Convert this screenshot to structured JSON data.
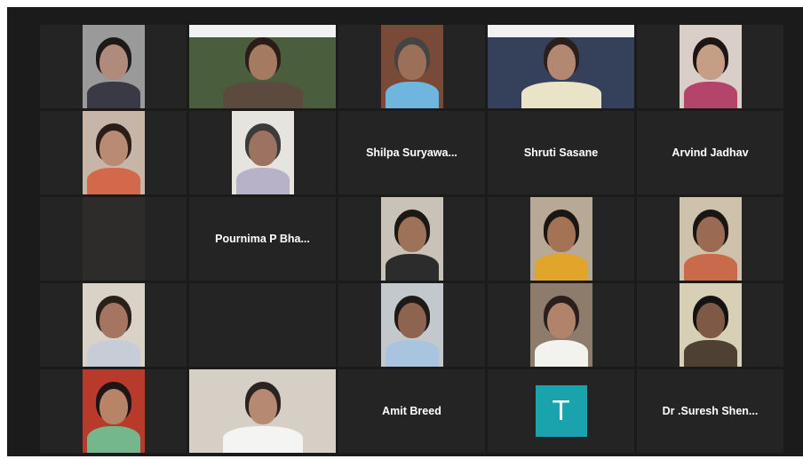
{
  "participants": [
    {
      "type": "video",
      "bg": "#9a9a9a",
      "skin": "#b08a7a",
      "hair": "#1e1a1a",
      "shirt": "#3a3a46"
    },
    {
      "type": "video",
      "bg": "#4a5d3d",
      "skin": "#a47a60",
      "hair": "#2a1d18",
      "shirt": "#5c4a3e",
      "active": true,
      "screen": true
    },
    {
      "type": "video",
      "bg": "#7a4a38",
      "skin": "#9c7058",
      "hair": "#444444",
      "shirt": "#6fb6de"
    },
    {
      "type": "video",
      "bg": "#35405a",
      "skin": "#b28872",
      "hair": "#2a1f1a",
      "shirt": "#e9e3c8",
      "screen": true
    },
    {
      "type": "video",
      "bg": "#d9cfc8",
      "skin": "#c69e86",
      "hair": "#1e1616",
      "shirt": "#b5446a"
    },
    {
      "type": "video",
      "bg": "#c7b6a8",
      "skin": "#b98a74",
      "hair": "#2a1e18",
      "shirt": "#d4684a"
    },
    {
      "type": "video",
      "bg": "#e6e4df",
      "skin": "#9c7260",
      "hair": "#3b3b3b",
      "shirt": "#b7b2c8"
    },
    {
      "type": "name",
      "name": "Shilpa  Suryawa..."
    },
    {
      "type": "name",
      "name": "Shruti Sasane"
    },
    {
      "type": "name",
      "name": "Arvind Jadhav"
    },
    {
      "type": "video",
      "bg": "#2e2b2b",
      "dark": true
    },
    {
      "type": "name",
      "name": "Pournima P Bha..."
    },
    {
      "type": "video",
      "bg": "#c9c2b9",
      "skin": "#9e7258",
      "hair": "#1c1814",
      "shirt": "#2c2c2c"
    },
    {
      "type": "video",
      "bg": "#b7a995",
      "skin": "#a47356",
      "hair": "#1a1614",
      "shirt": "#e0a52a"
    },
    {
      "type": "video",
      "bg": "#cfc2ad",
      "skin": "#9a6b52",
      "hair": "#1a1614",
      "shirt": "#c96a4a"
    },
    {
      "type": "video",
      "bg": "#d9d3c7",
      "skin": "#a47662",
      "hair": "#2a201a",
      "shirt": "#c7cdd6"
    },
    {
      "type": "empty"
    },
    {
      "type": "video",
      "bg": "#c2c8cc",
      "skin": "#8e6450",
      "hair": "#1e1a18",
      "shirt": "#a9c4de"
    },
    {
      "type": "video",
      "bg": "#8d7b6c",
      "skin": "#b0836a",
      "hair": "#2a1f1c",
      "shirt": "#f2f2ef"
    },
    {
      "type": "video",
      "bg": "#d8d0b6",
      "skin": "#7e5a46",
      "hair": "#141212",
      "shirt": "#4e4032"
    },
    {
      "type": "video",
      "bg": "#b83a2a",
      "skin": "#b88468",
      "hair": "#1e1616",
      "shirt": "#74b78c"
    },
    {
      "type": "video",
      "bg": "#d6cfc6",
      "skin": "#b68a72",
      "hair": "#2a2420",
      "shirt": "#f4f4f2",
      "wide": true
    },
    {
      "type": "name",
      "name": "Amit Breed"
    },
    {
      "type": "avatar",
      "initial": "T",
      "color": "#1aa3ad"
    },
    {
      "type": "name",
      "name": "Dr .Suresh Shen..."
    }
  ]
}
